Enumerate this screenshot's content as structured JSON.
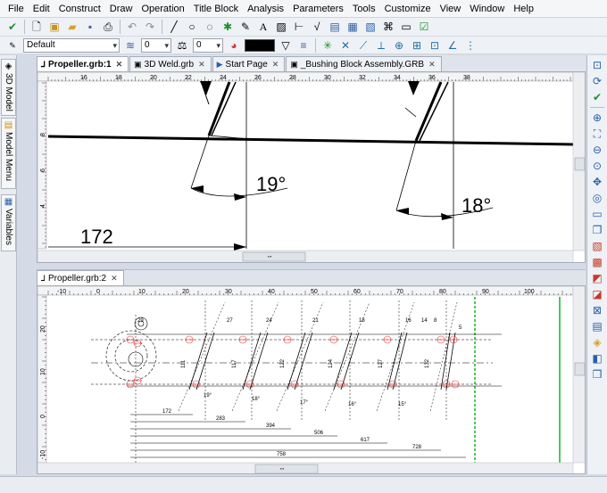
{
  "menu": [
    "File",
    "Edit",
    "Construct",
    "Draw",
    "Operation",
    "Title Block",
    "Analysis",
    "Parameters",
    "Tools",
    "Customize",
    "View",
    "Window",
    "Help"
  ],
  "toolbar2": {
    "style": "Default",
    "field1": "0",
    "field2": "0"
  },
  "left_tabs": [
    {
      "label": "3D Model",
      "icon": "cube-icon"
    },
    {
      "label": "Model Menu",
      "icon": "menu-icon"
    },
    {
      "label": "Variables",
      "icon": "variables-icon"
    }
  ],
  "doc_tabs": [
    {
      "label": "Propeller.grb:1",
      "active": true
    },
    {
      "label": "3D Weld.grb",
      "active": false
    },
    {
      "label": "Start Page",
      "active": false
    },
    {
      "label": "_Bushing Block Assembly.GRB",
      "active": false
    }
  ],
  "bottom_tab": {
    "label": "Propeller.grb:2"
  },
  "top_view": {
    "ruler_ticks": [
      "16",
      "18",
      "20",
      "22",
      "24",
      "26",
      "28",
      "30",
      "32",
      "34",
      "36",
      "38"
    ],
    "vruler_ticks": [
      "8",
      "6",
      "4"
    ],
    "dim_angle_left": "19°",
    "dim_angle_right": "18°",
    "dim_length": "172",
    "scroll_grip": "'''"
  },
  "bottom_view": {
    "ruler_ticks": [
      "-10",
      "0",
      "10",
      "20",
      "30",
      "40",
      "50",
      "60",
      "70",
      "80",
      "90",
      "100"
    ],
    "vruler_ticks": [
      "20",
      "10",
      "0",
      "-10"
    ],
    "horiz_dims": [
      "172",
      "283",
      "394",
      "506",
      "617",
      "728",
      "758"
    ],
    "vert_dims": [
      "111",
      "117",
      "122",
      "124",
      "127",
      "132"
    ],
    "angle_dims": [
      "19°",
      "18°",
      "17°",
      "16°",
      "15°"
    ],
    "top_dims": [
      "29",
      "27",
      "24",
      "21",
      "18",
      "16",
      "14",
      "8",
      "5"
    ],
    "scroll_grip": "'''"
  }
}
